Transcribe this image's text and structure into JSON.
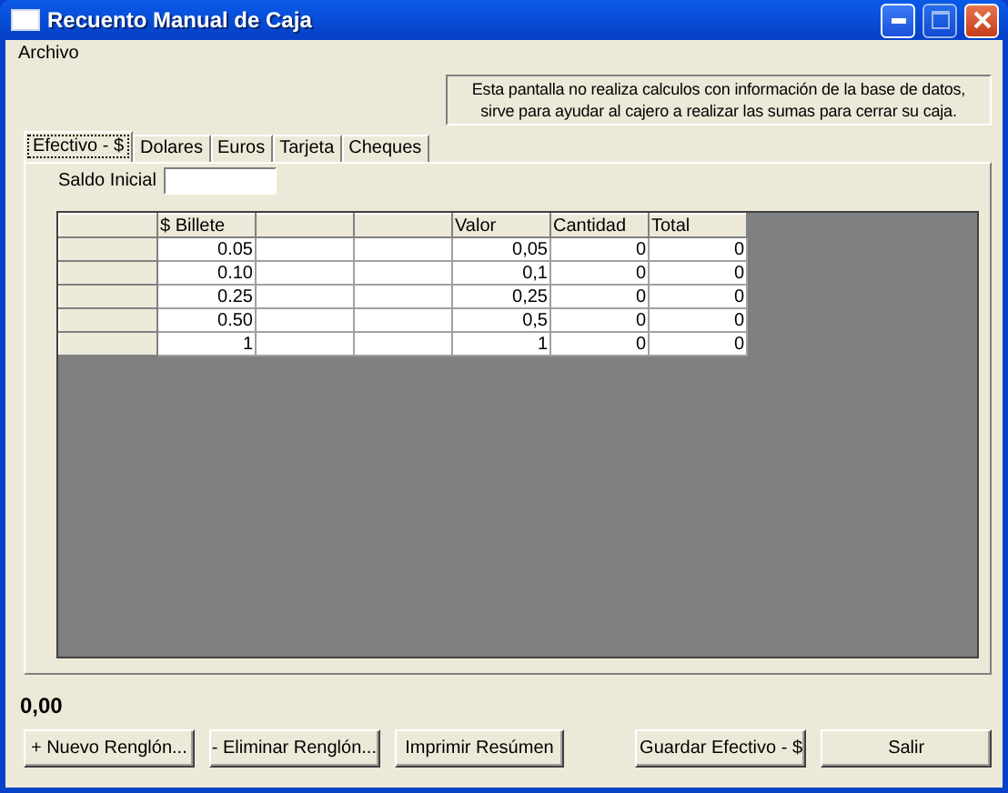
{
  "window": {
    "title": "Recuento Manual de Caja"
  },
  "menu": [
    "Archivo"
  ],
  "notice": "Esta pantalla no realiza calculos con información de la base de datos, sirve para ayudar al cajero a realizar las sumas para cerrar su caja.",
  "tabs": [
    {
      "label": "Efectivo - $",
      "selected": true
    },
    {
      "label": "Dolares",
      "selected": false
    },
    {
      "label": "Euros",
      "selected": false
    },
    {
      "label": "Tarjeta",
      "selected": false
    },
    {
      "label": "Cheques",
      "selected": false
    }
  ],
  "saldo_inicial": {
    "label": "Saldo Inicial"
  },
  "grid": {
    "columns": [
      {
        "label": "$ Billete"
      },
      {},
      {},
      {
        "label": "Valor"
      },
      {
        "label": "Cantidad"
      },
      {
        "label": "Total"
      }
    ],
    "rows": [
      {
        "cells": [
          "0.05",
          null,
          null,
          "0,05",
          "0",
          "0"
        ]
      },
      {
        "cells": [
          "0.10",
          null,
          null,
          "0,1",
          "0",
          "0"
        ]
      },
      {
        "cells": [
          "0.25",
          null,
          null,
          "0,25",
          "0",
          "0"
        ]
      },
      {
        "cells": [
          "0.50",
          null,
          null,
          "0,5",
          "0",
          "0"
        ]
      },
      {
        "cells": [
          "1",
          null,
          null,
          "1",
          "0",
          "0"
        ]
      }
    ]
  },
  "total": "0,00",
  "buttons": [
    {
      "label": "+ Nuevo Renglón..."
    },
    {
      "label": "- Eliminar Renglón..."
    },
    {
      "label": "Imprimir Resúmen"
    },
    {
      "label": "Guardar Efectivo - $",
      "gap_before": true
    },
    {
      "label": "Salir"
    }
  ]
}
